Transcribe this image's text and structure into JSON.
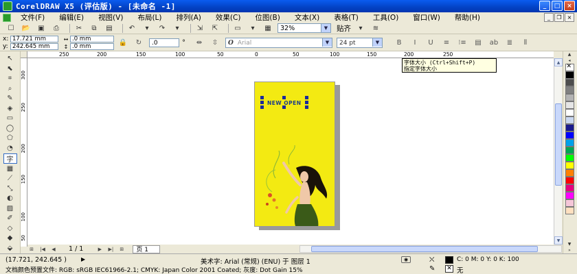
{
  "window": {
    "title": "CorelDRAW X5 (评估版) - [未命名 -1]",
    "minimize": "_",
    "maximize": "□",
    "close": "×"
  },
  "menu": {
    "items": [
      "文件(F)",
      "编辑(E)",
      "视图(V)",
      "布局(L)",
      "排列(A)",
      "效果(C)",
      "位图(B)",
      "文本(X)",
      "表格(T)",
      "工具(O)",
      "窗口(W)",
      "帮助(H)"
    ]
  },
  "toolbar": {
    "zoom_value": "32%",
    "snap_label": "贴齐"
  },
  "propbar": {
    "x_label": "x:",
    "y_label": "y:",
    "x_value": "17.721 mm",
    "y_value": "242.645 mm",
    "width_value": ".0 mm",
    "height_value": ".0 mm",
    "rotation_value": ".0",
    "degree_symbol": "°",
    "font_name": "Arial",
    "font_size": "24 pt"
  },
  "tooltip": {
    "line1": "字体大小 (Ctrl+Shift+P)",
    "line2": "指定字体大小"
  },
  "ruler": {
    "h_ticks": [
      "250",
      "200",
      "150",
      "100",
      "50",
      "0",
      "50",
      "100",
      "150",
      "200",
      "250"
    ],
    "v_ticks": [
      "300",
      "250",
      "200",
      "150",
      "100",
      "50"
    ]
  },
  "canvas": {
    "brand_text": "NEW OPEN",
    "page_color": "#f3ea12"
  },
  "pager": {
    "count": "1 / 1",
    "tab_label": "页 1"
  },
  "palette": {
    "colors": [
      "#000000",
      "#4d4d4d",
      "#808080",
      "#b3b3b3",
      "#e6e6e6",
      "#ffffff",
      "#c9d7f0",
      "#1a1a8c",
      "#0000ff",
      "#00a0e9",
      "#00a651",
      "#00ff00",
      "#ffff00",
      "#ff8000",
      "#ff0000",
      "#e6007e",
      "#ff00ff",
      "#f5c6d8",
      "#ffe0c0"
    ]
  },
  "status": {
    "coords": "(17.721, 242.645 )",
    "play": "▶",
    "object_info": "美术字: Arial (常规) (ENU) 于 图层 1",
    "doc_profile": "文档颜色预置文件: RGB: sRGB IEC61966-2.1; CMYK: Japan Color 2001 Coated; 灰度: Dot Gain 15%",
    "fill_text": "C: 0 M: 0 Y: 0 K: 100",
    "outline_text": "无",
    "fill_color": "#000000"
  }
}
